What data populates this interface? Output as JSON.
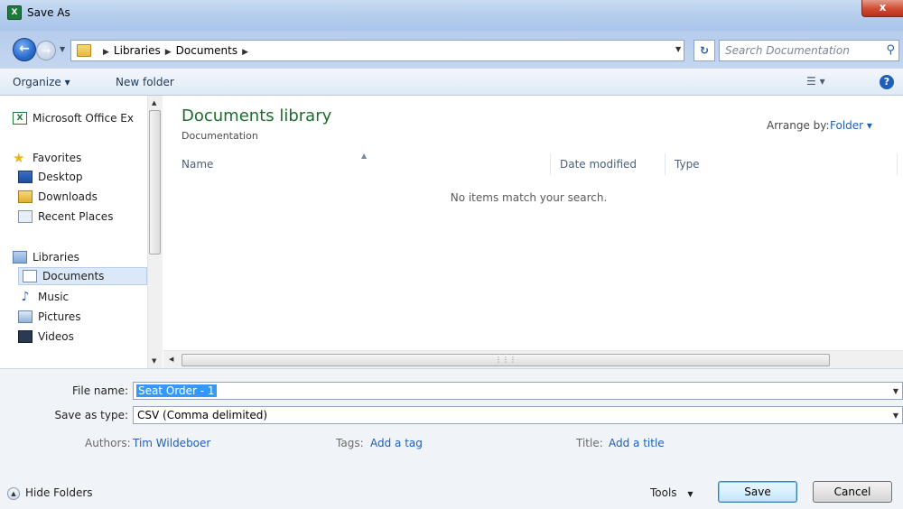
{
  "window": {
    "title": "Save As",
    "close_label": "x"
  },
  "address_bar": {
    "crumbs": [
      "Libraries",
      "Documents"
    ],
    "search_placeholder": "Search Documentation"
  },
  "toolbar": {
    "organize_label": "Organize ▾",
    "new_folder_label": "New folder"
  },
  "nav_pane": {
    "top_item": "Microsoft Office Ex",
    "favorites_label": "Favorites",
    "favorites": [
      "Desktop",
      "Downloads",
      "Recent Places"
    ],
    "libraries_label": "Libraries",
    "libraries": [
      "Documents",
      "Music",
      "Pictures",
      "Videos"
    ],
    "selected": "Documents"
  },
  "content": {
    "library_title": "Documents library",
    "library_subtitle": "Documentation",
    "arrange_label": "Arrange by:",
    "arrange_value": "Folder ▾",
    "columns": [
      "Name",
      "Date modified",
      "Type"
    ],
    "empty_message": "No items match your search."
  },
  "form": {
    "file_name_label": "File name:",
    "file_name_value": "Seat Order - 1",
    "save_type_label": "Save as type:",
    "save_type_value": "CSV (Comma delimited)",
    "authors_label": "Authors:",
    "authors_value": "Tim Wildeboer",
    "tags_label": "Tags:",
    "tags_value": "Add a tag",
    "title_label": "Title:",
    "title_value": "Add a title"
  },
  "footer": {
    "hide_folders_label": "Hide Folders",
    "tools_label": "Tools",
    "save_label": "Save",
    "cancel_label": "Cancel"
  },
  "colors": {
    "accent": "#1f5fb8",
    "library_title": "#1e6b2e",
    "selection": "#3399ff"
  }
}
